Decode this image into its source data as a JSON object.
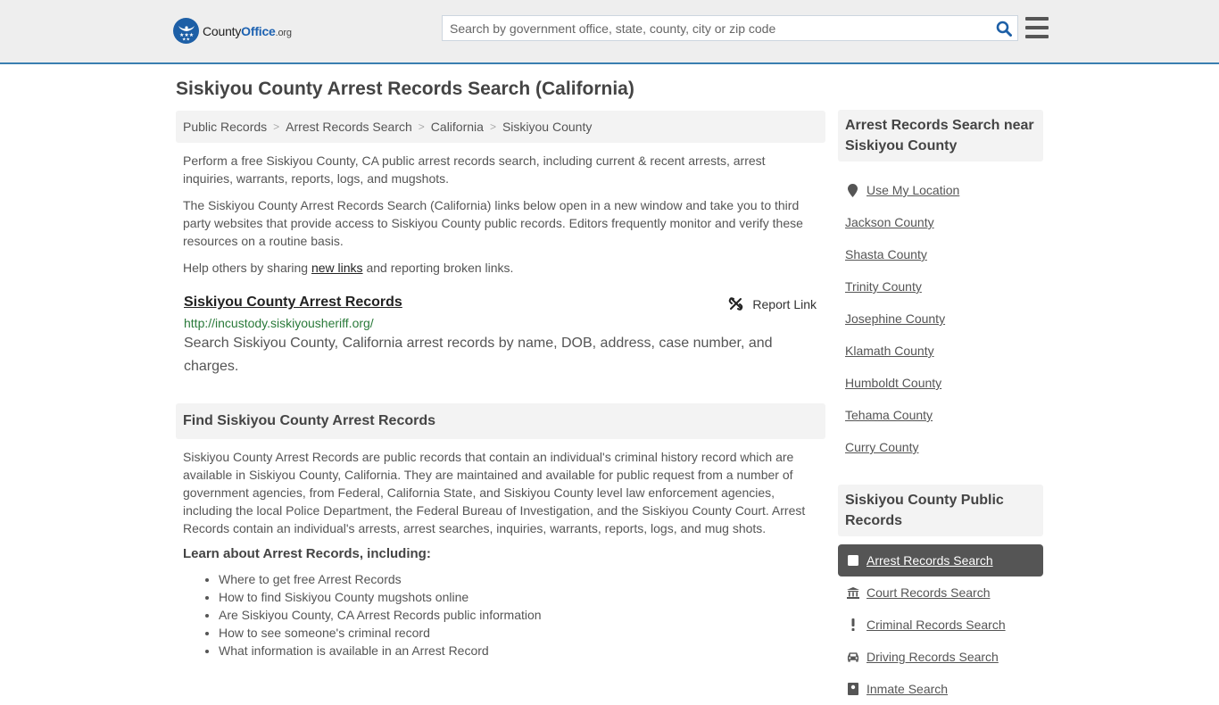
{
  "header": {
    "logo": {
      "brand_part1": "County",
      "brand_part2": "Office",
      "brand_part3": ".org"
    },
    "search": {
      "placeholder": "Search by government office, state, county, city or zip code",
      "value": ""
    },
    "icons": {
      "search": "search-icon",
      "menu": "hamburger-menu-icon"
    }
  },
  "page": {
    "title": "Siskiyou County Arrest Records Search (California)"
  },
  "breadcrumb": [
    {
      "label": "Public Records"
    },
    {
      "label": "Arrest Records Search"
    },
    {
      "label": "California"
    },
    {
      "label": "Siskiyou County"
    }
  ],
  "breadcrumb_separator": ">",
  "intro": {
    "p1": "Perform a free Siskiyou County, CA public arrest records search, including current & recent arrests, arrest inquiries, warrants, reports, logs, and mugshots.",
    "p2": "The Siskiyou County Arrest Records Search (California) links below open in a new window and take you to third party websites that provide access to Siskiyou County public records. Editors frequently monitor and verify these resources on a routine basis.",
    "p3_before": "Help others by sharing ",
    "p3_link": "new links",
    "p3_after": " and reporting broken links."
  },
  "result": {
    "title": "Siskiyou County Arrest Records",
    "url": "http://incustody.siskiyousheriff.org/",
    "description": "Search Siskiyou County, California arrest records by name, DOB, address, case number, and charges.",
    "report_label": "Report Link"
  },
  "find_section": {
    "heading": "Find Siskiyou County Arrest Records",
    "body": "Siskiyou County Arrest Records are public records that contain an individual's criminal history record which are available in Siskiyou County, California. They are maintained and available for public request from a number of government agencies, from Federal, California State, and Siskiyou County level law enforcement agencies, including the local Police Department, the Federal Bureau of Investigation, and the Siskiyou County Court. Arrest Records contain an individual's arrests, arrest searches, inquiries, warrants, reports, logs, and mug shots.",
    "learn_heading": "Learn about Arrest Records, including:",
    "learn_items": [
      "Where to get free Arrest Records",
      "How to find Siskiyou County mugshots online",
      "Are Siskiyou County, CA Arrest Records public information",
      "How to see someone's criminal record",
      "What information is available in an Arrest Record"
    ]
  },
  "sidebar": {
    "nearby_heading": "Arrest Records Search near Siskiyou County",
    "use_location": "Use My Location",
    "nearby": [
      "Jackson County",
      "Shasta County",
      "Trinity County",
      "Josephine County",
      "Klamath County",
      "Humboldt County",
      "Tehama County",
      "Curry County"
    ],
    "public_records_heading": "Siskiyou County Public Records",
    "public_records": [
      {
        "label": "Arrest Records Search",
        "icon": "square-icon",
        "active": true
      },
      {
        "label": "Court Records Search",
        "icon": "courthouse-icon",
        "active": false
      },
      {
        "label": "Criminal Records Search",
        "icon": "exclamation-icon",
        "active": false
      },
      {
        "label": "Driving Records Search",
        "icon": "car-icon",
        "active": false
      },
      {
        "label": "Inmate Search",
        "icon": "inmate-icon",
        "active": false
      }
    ]
  },
  "colors": {
    "brand_blue": "#1d62b1",
    "header_border": "#3a7fb0",
    "url_green": "#2a7a3a",
    "active_bg": "#555555"
  }
}
